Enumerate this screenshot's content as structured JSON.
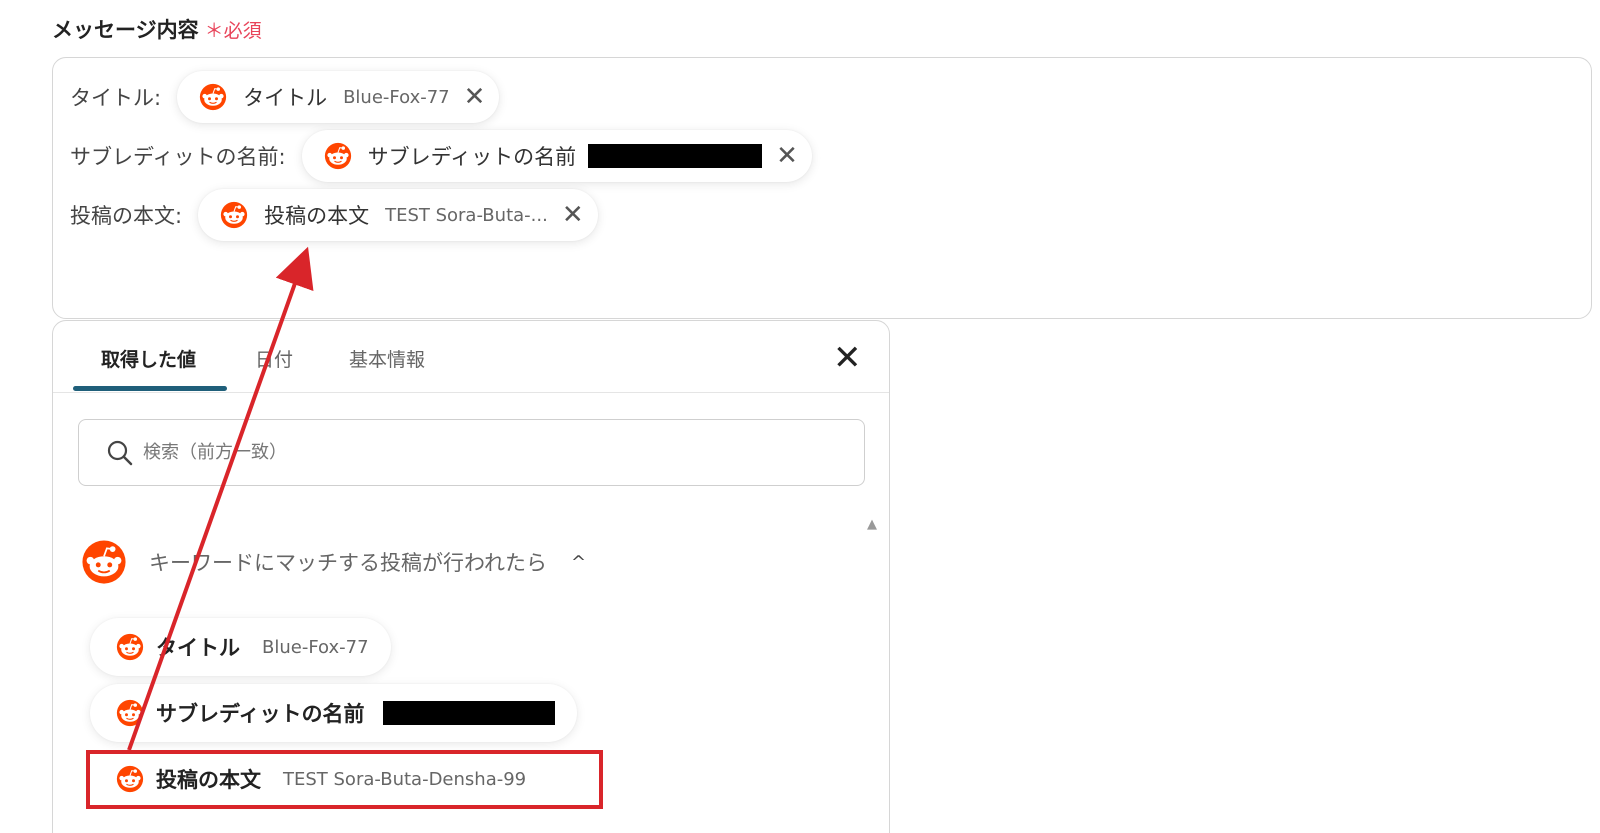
{
  "field": {
    "label": "メッセージ内容",
    "required_mark": "＊",
    "required_text": "必須"
  },
  "editor": {
    "rows": [
      {
        "label": "タイトル:",
        "pill_name": "タイトル",
        "pill_value": "Blue-Fox-77",
        "close": "✕"
      },
      {
        "label": "サブレディットの名前:",
        "pill_name": "サブレディットの名前",
        "pill_value": "",
        "close": "✕"
      },
      {
        "label": "投稿の本文:",
        "pill_name": "投稿の本文",
        "pill_value": "TEST Sora-Buta-...",
        "close": "✕"
      }
    ]
  },
  "panel": {
    "tabs": [
      {
        "label": "取得した値",
        "active": true
      },
      {
        "label": "日付",
        "active": false
      },
      {
        "label": "基本情報",
        "active": false
      }
    ],
    "close": "✕",
    "search": {
      "placeholder": "検索（前方一致）"
    },
    "group": {
      "title": "キーワードにマッチする投稿が行われたら",
      "chevron": "^",
      "items": [
        {
          "name": "タイトル",
          "value": "Blue-Fox-77"
        },
        {
          "name": "サブレディットの名前",
          "value": ""
        },
        {
          "name": "投稿の本文",
          "value": "TEST Sora-Buta-Densha-99"
        }
      ]
    },
    "scroll_up": "▲"
  },
  "colors": {
    "reddit": "#ff4500",
    "required": "#e8445a",
    "tab_underline": "#1f5f7a",
    "annotation": "#d9252a"
  },
  "icons": {
    "reddit": "reddit-logo-icon",
    "search": "search-icon",
    "close": "close-icon",
    "chevron": "chevron-up-icon"
  }
}
